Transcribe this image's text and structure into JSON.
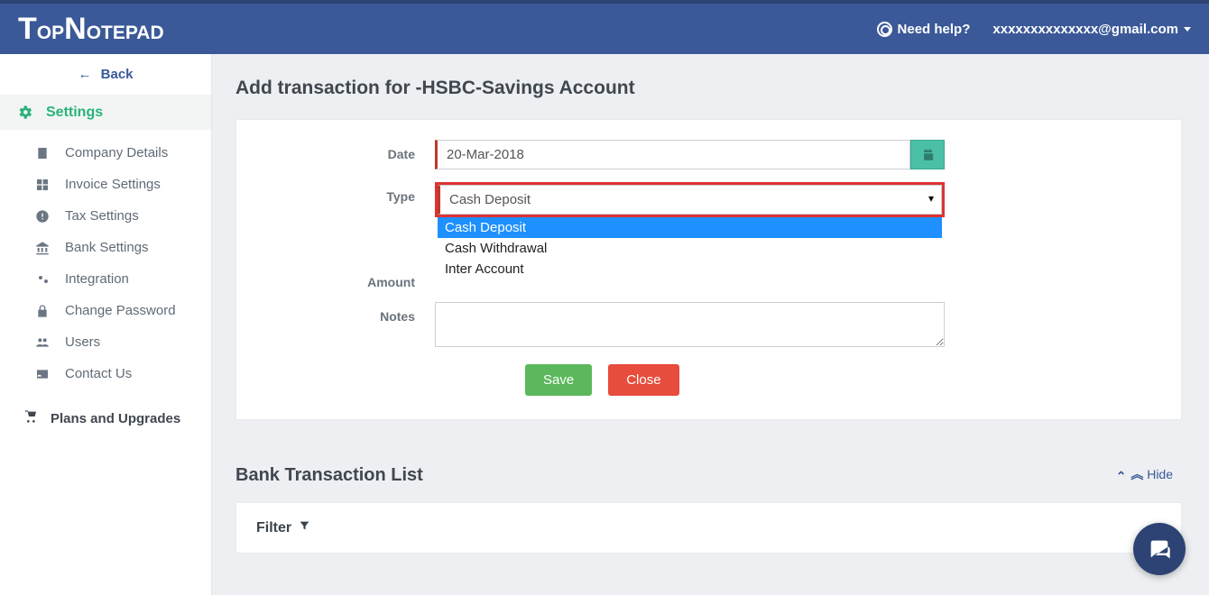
{
  "header": {
    "brand": "TopNotepad",
    "help": "Need help?",
    "user": "xxxxxxxxxxxxxx@gmail.com"
  },
  "sidebar": {
    "back": "Back",
    "settings": "Settings",
    "items": [
      {
        "label": "Company Details"
      },
      {
        "label": "Invoice Settings"
      },
      {
        "label": "Tax Settings"
      },
      {
        "label": "Bank Settings"
      },
      {
        "label": "Integration"
      },
      {
        "label": "Change Password"
      },
      {
        "label": "Users"
      },
      {
        "label": "Contact Us"
      }
    ],
    "plans": "Plans and Upgrades"
  },
  "main": {
    "page_title": "Add transaction for -HSBC-Savings Account",
    "form": {
      "date_label": "Date",
      "date_value": "20-Mar-2018",
      "type_label": "Type",
      "type_value": "Cash Deposit",
      "type_options": [
        "Cash Deposit",
        "Cash Withdrawal",
        "Inter Account"
      ],
      "amount_label": "Amount",
      "notes_label": "Notes",
      "save": "Save",
      "close": "Close"
    },
    "hide": "Hide",
    "list_title": "Bank Transaction List",
    "filter": "Filter"
  }
}
